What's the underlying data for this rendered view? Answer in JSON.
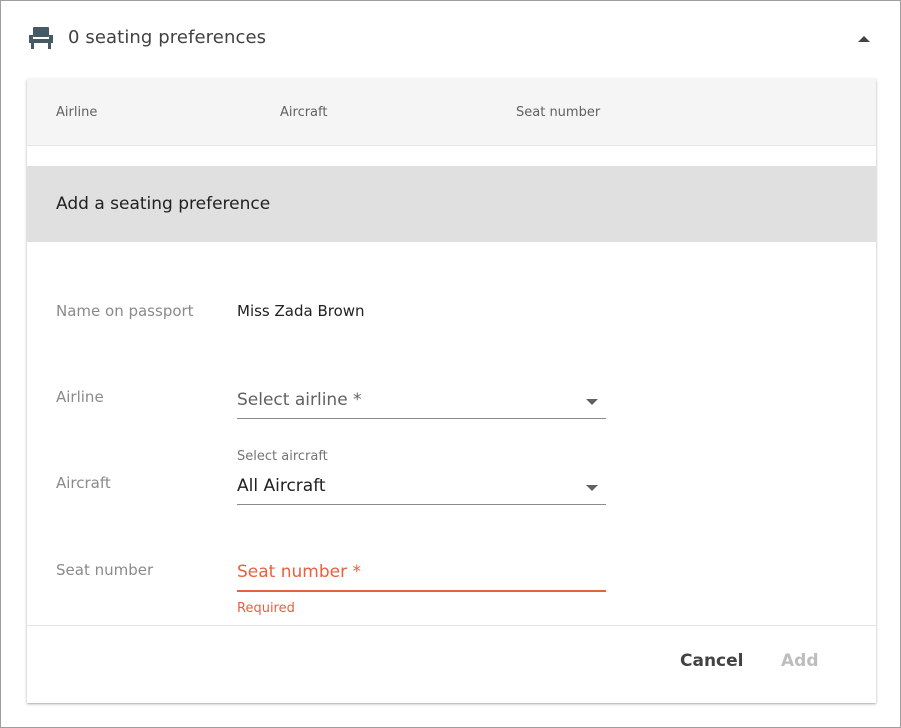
{
  "header": {
    "title": "0 seating preferences",
    "icon": "seat-icon",
    "collapse_icon": "chevron-up-icon"
  },
  "table": {
    "columns": [
      "Airline",
      "Aircraft",
      "Seat number"
    ]
  },
  "form": {
    "title": "Add a seating preference",
    "name_label": "Name on passport",
    "name_value": "Miss Zada Brown",
    "airline_label": "Airline",
    "airline_placeholder": "Select airline *",
    "aircraft_label": "Aircraft",
    "aircraft_float_label": "Select aircraft",
    "aircraft_value": "All Aircraft",
    "seat_label": "Seat number",
    "seat_placeholder": "Seat number *",
    "seat_error": "Required"
  },
  "actions": {
    "cancel_label": "Cancel",
    "add_label": "Add"
  },
  "colors": {
    "error": "#e8613c",
    "header_band": "#f5f5f5",
    "form_band": "#e0e0e0",
    "disabled": "#bdbdbd"
  }
}
